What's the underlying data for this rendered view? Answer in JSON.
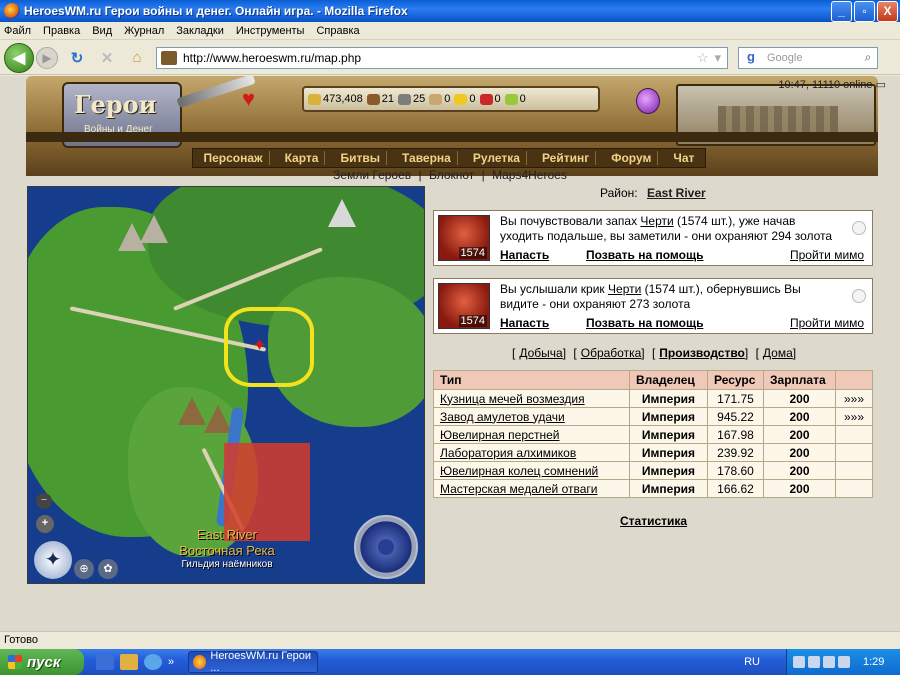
{
  "window": {
    "title": "HeroesWM.ru Герои войны и денег. Онлайн игра. - Mozilla Firefox",
    "minimize": "_",
    "maximize": "▫",
    "close": "X"
  },
  "menu": [
    "Файл",
    "Правка",
    "Вид",
    "Журнал",
    "Закладки",
    "Инструменты",
    "Справка"
  ],
  "nav": {
    "url": "http://www.heroeswm.ru/map.php",
    "search_engine": "g",
    "search_placeholder": "Google"
  },
  "header": {
    "clock": "10:47, 11110 online",
    "logo_title": "Герои",
    "logo_subtitle": "Войны и Денег",
    "resources": [
      {
        "value": "473,408",
        "color": "#d9b23a"
      },
      {
        "value": "21",
        "color": "#8a5a2c"
      },
      {
        "value": "25",
        "color": "#7d7d7d"
      },
      {
        "value": "0",
        "color": "#c8a870"
      },
      {
        "value": "0",
        "color": "#f0c820"
      },
      {
        "value": "0",
        "color": "#c82a2a"
      },
      {
        "value": "0",
        "color": "#9ac83a"
      }
    ],
    "game_nav": [
      "Персонаж",
      "Карта",
      "Битвы",
      "Таверна",
      "Рулетка",
      "Рейтинг",
      "Форум",
      "Чат"
    ],
    "sublinks": [
      "Земли Героев",
      "|",
      "Блокнот",
      "|",
      "Maps4Heroes"
    ]
  },
  "map": {
    "label_en": "East River",
    "label_ru": "Восточная Река",
    "label_guild": "Гильдия наёмников",
    "zoom_in": "+",
    "zoom_out": "−"
  },
  "region": {
    "label": "Район:",
    "name": "East River"
  },
  "encounters": [
    {
      "count": "1574",
      "text_before": "Вы почувствовали запах ",
      "monster": "Черти",
      "text_after": " (1574 шт.), уже начав уходить подальше, вы заметили - они охраняют 294 золота",
      "attack": "Напасть",
      "call_help": "Позвать на помощь",
      "pass": "Пройти мимо"
    },
    {
      "count": "1574",
      "text_before": "Вы услышали крик ",
      "monster": "Черти",
      "text_after": " (1574 шт.), обернувшись Вы видите - они охраняют 273 золота",
      "attack": "Напасть",
      "call_help": "Позвать на помощь",
      "pass": "Пройти мимо"
    }
  ],
  "tabs": [
    "Добыча",
    "Обработка",
    "Производство",
    "Дома"
  ],
  "table": {
    "headers": [
      "Тип",
      "Владелец",
      "Ресурс",
      "Зарплата",
      ""
    ],
    "rows": [
      {
        "type": "Кузница мечей возмездия",
        "owner": "Империя",
        "resource": "171.75",
        "salary": "200",
        "more": "»»»"
      },
      {
        "type": "Завод амулетов удачи",
        "owner": "Империя",
        "resource": "945.22",
        "salary": "200",
        "more": "»»»"
      },
      {
        "type": "Ювелирная перстней",
        "owner": "Империя",
        "resource": "167.98",
        "salary": "200",
        "more": ""
      },
      {
        "type": "Лаборатория алхимиков",
        "owner": "Империя",
        "resource": "239.92",
        "salary": "200",
        "more": ""
      },
      {
        "type": "Ювелирная колец сомнений",
        "owner": "Империя",
        "resource": "178.60",
        "salary": "200",
        "more": ""
      },
      {
        "type": "Мастерская медалей отваги",
        "owner": "Империя",
        "resource": "166.62",
        "salary": "200",
        "more": ""
      }
    ]
  },
  "stats_link": "Статистика",
  "status": "Готово",
  "taskbar": {
    "start": "пуск",
    "task": "HeroesWM.ru Герои ...",
    "lang": "RU",
    "time": "1:29"
  }
}
